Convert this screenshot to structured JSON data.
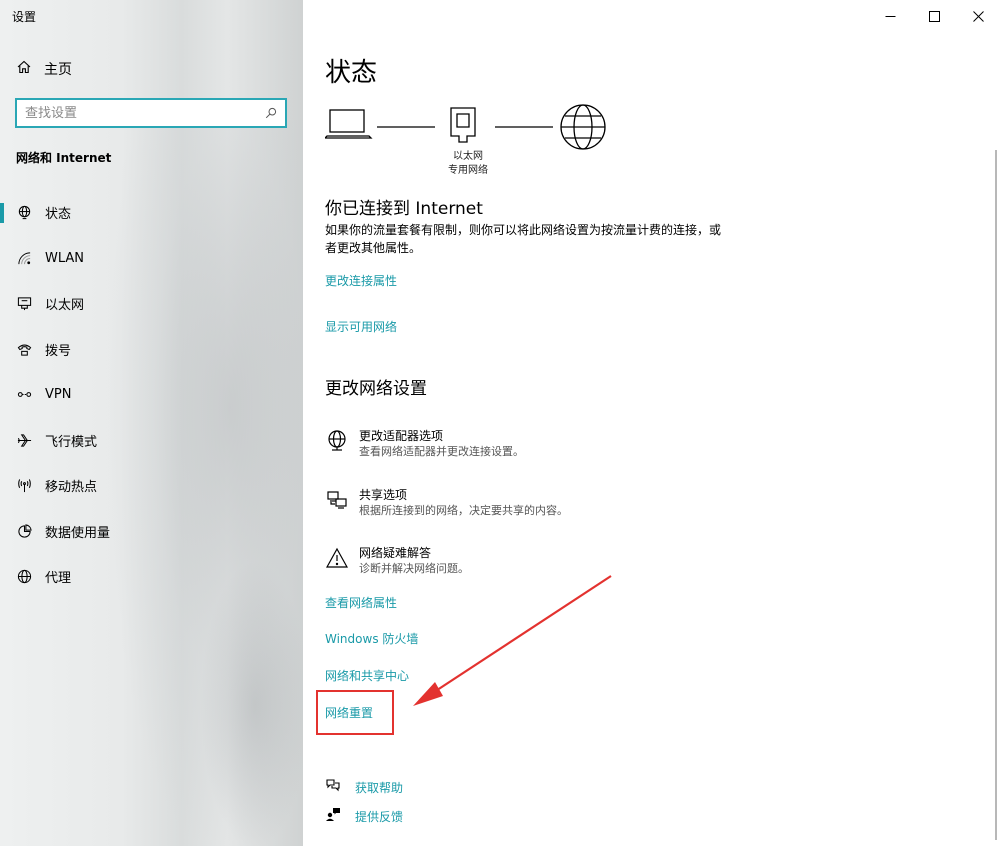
{
  "app": {
    "title": "设置"
  },
  "sidebar": {
    "home_label": "主页",
    "search_placeholder": "查找设置",
    "section_title": "网络和 Internet",
    "items": [
      {
        "label": "状态",
        "icon": "status-globe-icon",
        "active": true
      },
      {
        "label": "WLAN",
        "icon": "wifi-icon"
      },
      {
        "label": "以太网",
        "icon": "ethernet-icon"
      },
      {
        "label": "拨号",
        "icon": "dialup-phone-icon"
      },
      {
        "label": "VPN",
        "icon": "vpn-icon"
      },
      {
        "label": "飞行模式",
        "icon": "airplane-icon"
      },
      {
        "label": "移动热点",
        "icon": "hotspot-icon"
      },
      {
        "label": "数据使用量",
        "icon": "data-usage-icon"
      },
      {
        "label": "代理",
        "icon": "proxy-globe-icon"
      }
    ]
  },
  "main": {
    "title": "状态",
    "diagram": {
      "line1": "以太网",
      "line2": "专用网络"
    },
    "connected_title": "你已连接到 Internet",
    "connected_desc": "如果你的流量套餐有限制，则你可以将此网络设置为按流量计费的连接，或者更改其他属性。",
    "link_change_conn": "更改连接属性",
    "link_show_networks": "显示可用网络",
    "section_change": "更改网络设置",
    "options": [
      {
        "title": "更改适配器选项",
        "desc": "查看网络适配器并更改连接设置。",
        "icon": "adapter-globe-icon"
      },
      {
        "title": "共享选项",
        "desc": "根据所连接到的网络，决定要共享的内容。",
        "icon": "sharing-icon"
      },
      {
        "title": "网络疑难解答",
        "desc": "诊断并解决网络问题。",
        "icon": "warning-icon"
      }
    ],
    "link_view_props": "查看网络属性",
    "link_firewall": "Windows 防火墙",
    "link_sharing_center": "网络和共享中心",
    "link_reset": "网络重置",
    "help": {
      "get_help": "获取帮助",
      "feedback": "提供反馈"
    }
  },
  "colors": {
    "accent": "#1a9aa8",
    "annotation": "#e3322f"
  }
}
